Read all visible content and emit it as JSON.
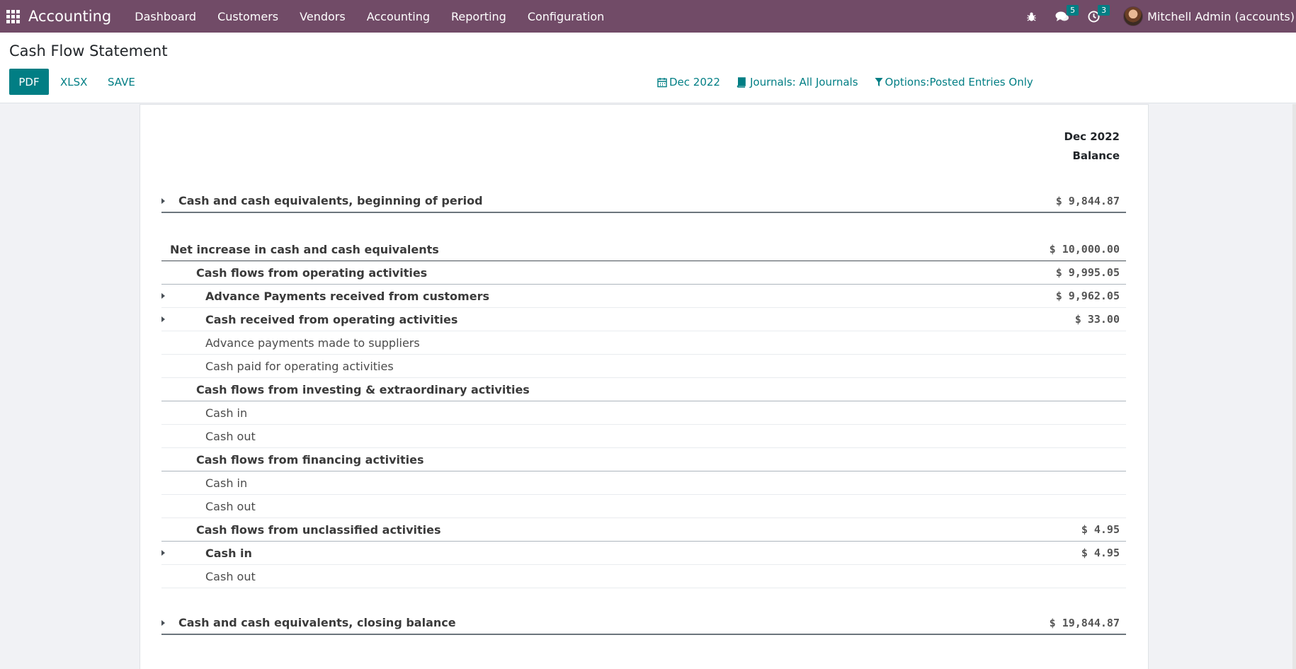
{
  "navbar": {
    "app_name": "Accounting",
    "menu": [
      "Dashboard",
      "Customers",
      "Vendors",
      "Accounting",
      "Reporting",
      "Configuration"
    ],
    "messages_count": "5",
    "activities_count": "3",
    "user": "Mitchell Admin (accounts)"
  },
  "control": {
    "title": "Cash Flow Statement",
    "pdf": "PDF",
    "xlsx": "XLSX",
    "save": "SAVE",
    "filter_date": "Dec 2022",
    "filter_journals": "Journals: All Journals",
    "filter_options": "Options:Posted Entries Only"
  },
  "report": {
    "col_period": "Dec 2022",
    "col_label": "Balance",
    "rows": [
      {
        "label": "Cash and cash equivalents, beginning of period",
        "amount": "$ 9,844.87"
      },
      {
        "label": "Net increase in cash and cash equivalents",
        "amount": "$ 10,000.00"
      },
      {
        "label": "Cash flows from operating activities",
        "amount": "$ 9,995.05"
      },
      {
        "label": "Advance Payments received from customers",
        "amount": "$ 9,962.05"
      },
      {
        "label": "Cash received from operating activities",
        "amount": "$ 33.00"
      },
      {
        "label": "Advance payments made to suppliers",
        "amount": ""
      },
      {
        "label": "Cash paid for operating activities",
        "amount": ""
      },
      {
        "label": "Cash flows from investing & extraordinary activities",
        "amount": ""
      },
      {
        "label": "Cash in",
        "amount": ""
      },
      {
        "label": "Cash out",
        "amount": ""
      },
      {
        "label": "Cash flows from financing activities",
        "amount": ""
      },
      {
        "label": "Cash in",
        "amount": ""
      },
      {
        "label": "Cash out",
        "amount": ""
      },
      {
        "label": "Cash flows from unclassified activities",
        "amount": "$ 4.95"
      },
      {
        "label": "Cash in",
        "amount": "$ 4.95"
      },
      {
        "label": "Cash out",
        "amount": ""
      },
      {
        "label": "Cash and cash equivalents, closing balance",
        "amount": "$ 19,844.87"
      }
    ]
  }
}
